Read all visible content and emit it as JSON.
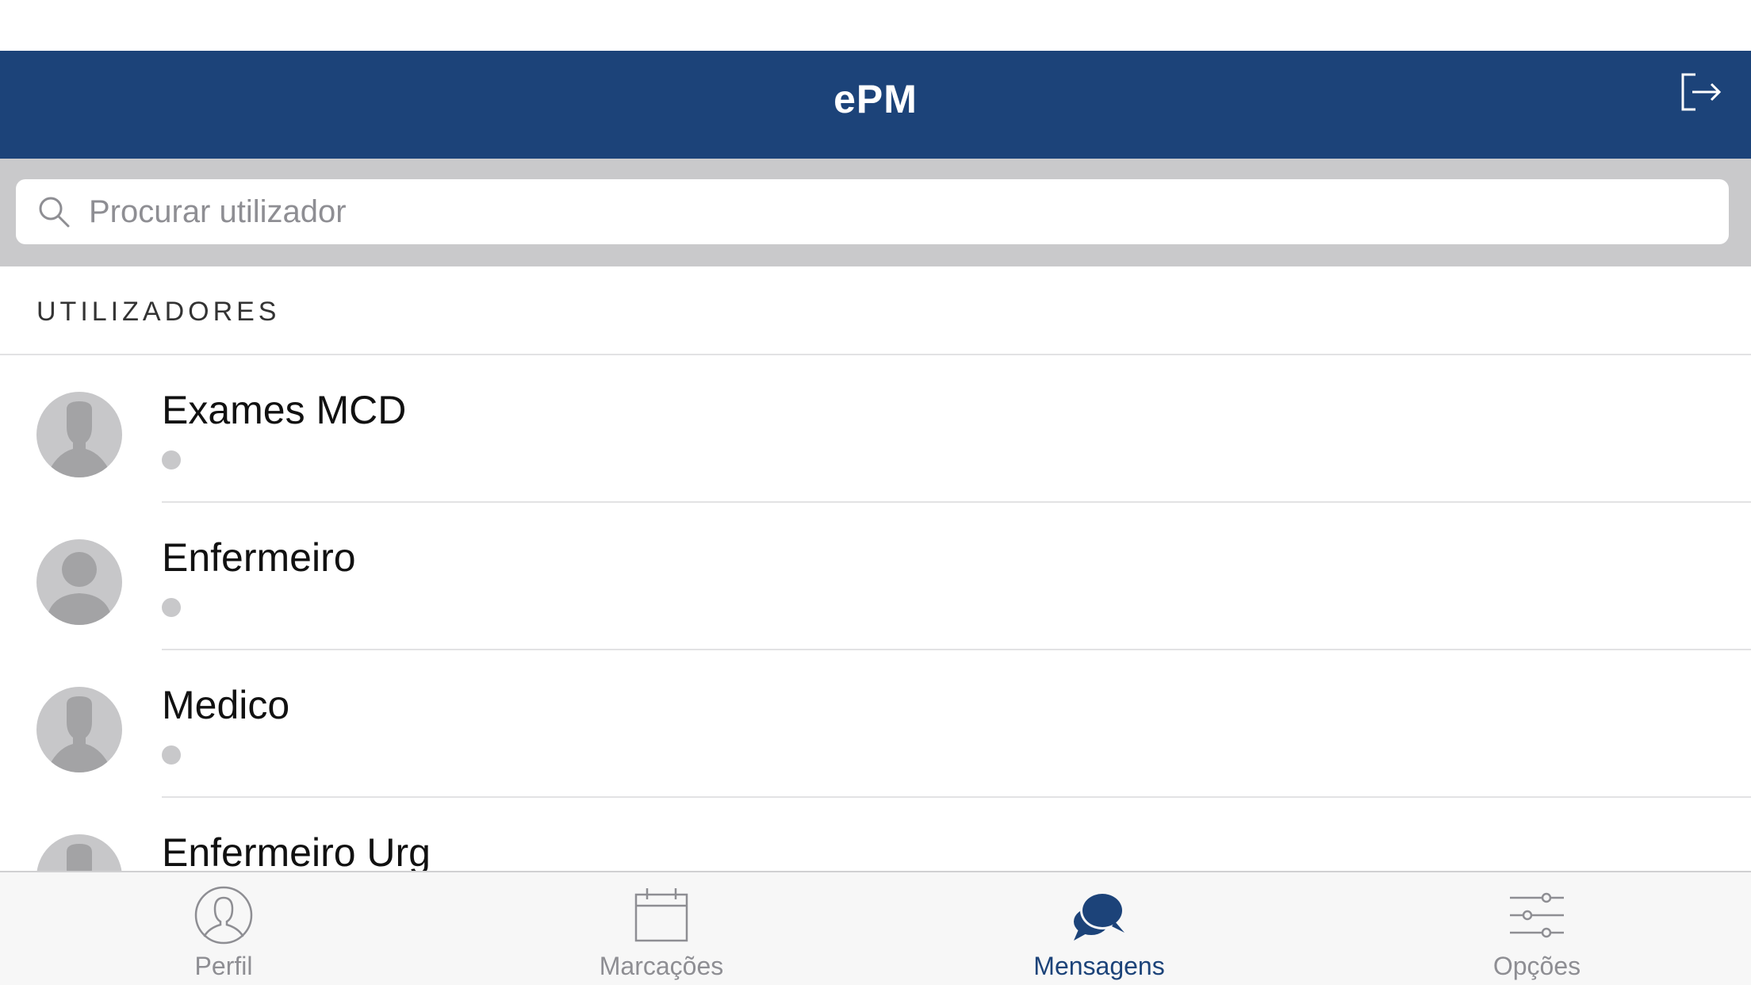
{
  "app": {
    "title": "ePM"
  },
  "search": {
    "placeholder": "Procurar utilizador",
    "value": ""
  },
  "section": {
    "header": "UTILIZADORES"
  },
  "users": [
    {
      "name": "Exames MCD",
      "avatar": "person-silhouette"
    },
    {
      "name": "Enfermeiro",
      "avatar": "person-generic"
    },
    {
      "name": "Medico",
      "avatar": "person-silhouette"
    },
    {
      "name": "Enfermeiro Urg",
      "avatar": "person-silhouette"
    }
  ],
  "tabs": [
    {
      "label": "Perfil",
      "icon": "profile-icon",
      "active": false
    },
    {
      "label": "Marcações",
      "icon": "calendar-icon",
      "active": false
    },
    {
      "label": "Mensagens",
      "icon": "chat-bubbles-icon",
      "active": true
    },
    {
      "label": "Opções",
      "icon": "sliders-icon",
      "active": false
    }
  ],
  "colors": {
    "navbar": "#1c4379",
    "accent": "#1c4379",
    "search_area": "#c9c9cb",
    "inactive_tab": "#8e8e93",
    "status_dot": "#c8c8ca"
  }
}
